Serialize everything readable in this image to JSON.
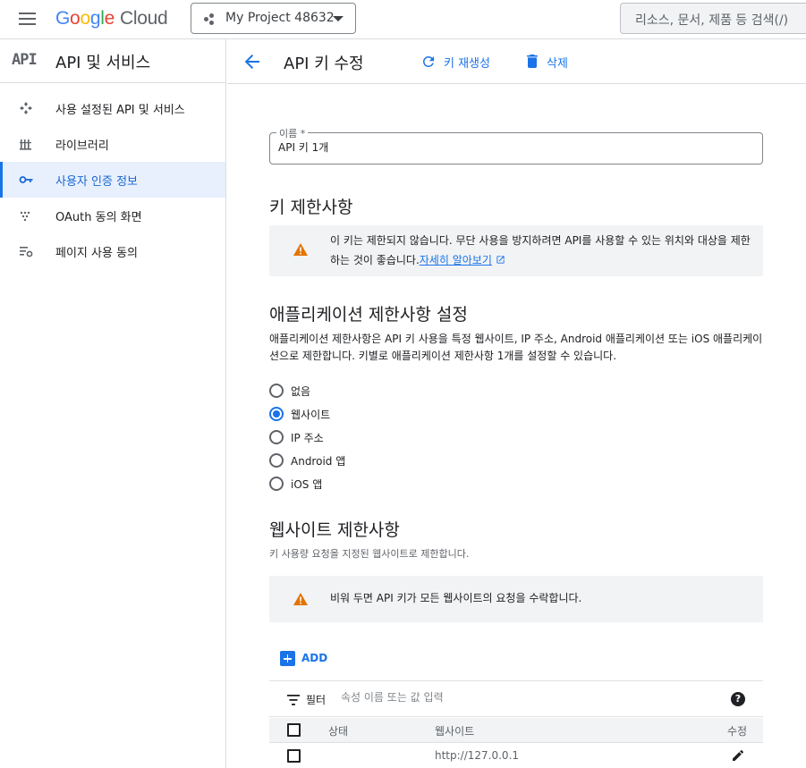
{
  "topbar": {
    "logo_letters": [
      "G",
      "o",
      "o",
      "g",
      "l",
      "e"
    ],
    "logo_cloud": "Cloud",
    "project_name": "My Project 48632",
    "search_placeholder": "리소스, 문서, 제품 등 검색(/)"
  },
  "sidebar": {
    "header_icon_text": "API",
    "title": "API 및 서비스",
    "items": [
      {
        "label": "사용 설정된 API 및 서비스",
        "icon": "hub-icon",
        "active": false
      },
      {
        "label": "라이브러리",
        "icon": "library-icon",
        "active": false
      },
      {
        "label": "사용자 인증 정보",
        "icon": "key-icon",
        "active": true
      },
      {
        "label": "OAuth 동의 화면",
        "icon": "oauth-dots-icon",
        "active": false
      },
      {
        "label": "페이지 사용 동의",
        "icon": "page-settings-icon",
        "active": false
      }
    ]
  },
  "header": {
    "title": "API 키 수정",
    "regenerate_label": "키 재생성",
    "delete_label": "삭제"
  },
  "form": {
    "name_label": "이름 *",
    "name_value": "API 키 1개"
  },
  "key_restrictions": {
    "heading": "키 제한사항",
    "notice_text": "이 키는 제한되지 않습니다. 무단 사용을 방지하려면 API를 사용할 수 있는 위치와 대상을 제한하는 것이 좋습니다.",
    "notice_link": "자세히 알아보기"
  },
  "app_restrictions": {
    "heading": "애플리케이션 제한사항 설정",
    "description": "애플리케이션 제한사항은 API 키 사용을 특정 웹사이트, IP 주소, Android 애플리케이션 또는 iOS 애플리케이션으로 제한합니다. 키별로 애플리케이션 제한사항 1개를 설정할 수 있습니다.",
    "options": [
      {
        "label": "없음",
        "checked": false
      },
      {
        "label": "웹사이트",
        "checked": true
      },
      {
        "label": "IP 주소",
        "checked": false
      },
      {
        "label": "Android 앱",
        "checked": false
      },
      {
        "label": "iOS 앱",
        "checked": false
      }
    ]
  },
  "website_restrictions": {
    "heading": "웹사이트 제한사항",
    "subtitle": "키 사용량 요청을 지정된 웹사이트로 제한합니다.",
    "notice_text": "비워 두면 API 키가 모든 웹사이트의 요청을 수락합니다.",
    "add_label": "ADD",
    "filter_label": "필터",
    "filter_placeholder": "속성 이름 또는 값 입력",
    "help_glyph": "?",
    "columns": [
      "상태",
      "웹사이트",
      "수정"
    ],
    "rows": [
      {
        "status": "",
        "website": "http://127.0.0.1"
      }
    ]
  },
  "colors": {
    "accent": "#1a73e8",
    "warning": "#e37400",
    "notice_bg": "#f1f3f4"
  }
}
